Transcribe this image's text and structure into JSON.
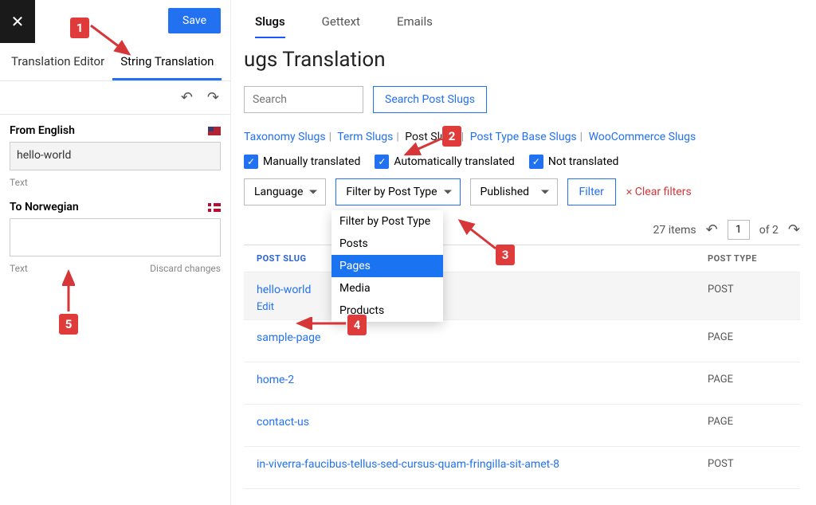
{
  "sidebar": {
    "save_label": "Save",
    "tabs": [
      "Translation Editor",
      "String Translation"
    ],
    "from_label": "From English",
    "from_value": "hello-world",
    "from_type": "Text",
    "to_label": "To Norwegian",
    "to_value": "",
    "to_type": "Text",
    "discard_label": "Discard changes"
  },
  "top_tabs": [
    "Slugs",
    "Gettext",
    "Emails"
  ],
  "page_title": "ugs Translation",
  "search_placeholder": "Search",
  "search_button": "Search Post Slugs",
  "slug_categories": [
    "Taxonomy Slugs",
    "Term Slugs",
    "Post Slugs",
    "Post Type Base Slugs",
    "WooCommerce Slugs"
  ],
  "checks": [
    "Manually translated",
    "Automatically translated",
    "Not translated"
  ],
  "filters": {
    "language": "Language",
    "post_type": "Filter by Post Type",
    "status": "Published",
    "filter_btn": "Filter",
    "clear": "Clear filters"
  },
  "dropdown_items": [
    "Filter by Post Type",
    "Posts",
    "Pages",
    "Media",
    "Products"
  ],
  "pagination": {
    "count": "27 items",
    "page": "1",
    "total": "of 2"
  },
  "columns": {
    "slug": "POST SLUG",
    "type": "POST TYPE"
  },
  "edit_label": "Edit",
  "rows": [
    {
      "slug": "hello-world",
      "type": "POST"
    },
    {
      "slug": "sample-page",
      "type": "PAGE"
    },
    {
      "slug": "home-2",
      "type": "PAGE"
    },
    {
      "slug": "contact-us",
      "type": "PAGE"
    },
    {
      "slug": "in-viverra-faucibus-tellus-sed-cursus-quam-fringilla-sit-amet-8",
      "type": "POST"
    }
  ],
  "callouts": {
    "c1": "1",
    "c2": "2",
    "c3": "3",
    "c4": "4",
    "c5": "5"
  }
}
